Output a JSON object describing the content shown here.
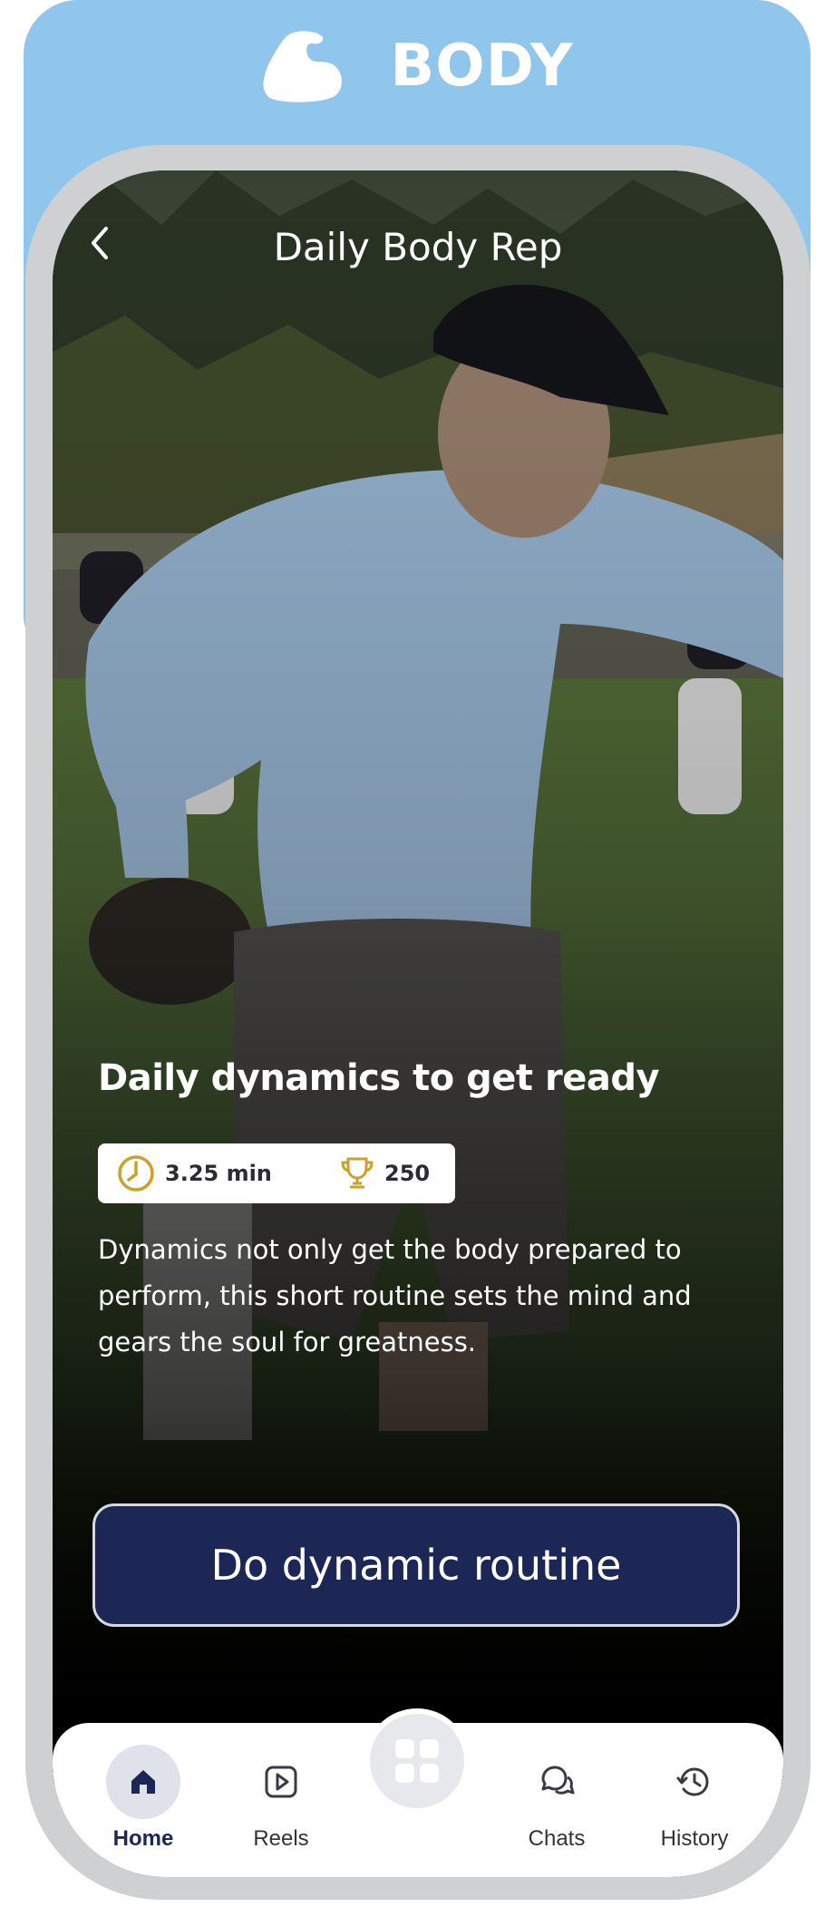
{
  "brand": {
    "name": "BODY",
    "icon": "flexed-bicep-icon"
  },
  "screen": {
    "title": "Daily Body Rep",
    "back_icon": "chevron-left-icon"
  },
  "card": {
    "title": "Daily dynamics to get ready",
    "duration": "3.25 min",
    "points": "250",
    "description": "Dynamics not only get the body prepared to perform, this short routine sets the mind and gears the soul for greatness."
  },
  "cta": {
    "label": "Do dynamic routine"
  },
  "nav": {
    "items": [
      {
        "label": "Home",
        "icon": "home-icon",
        "active": true
      },
      {
        "label": "Reels",
        "icon": "play-square-icon",
        "active": false
      },
      {
        "label": "",
        "icon": "grid-icon",
        "active": false
      },
      {
        "label": "Chats",
        "icon": "chat-bubbles-icon",
        "active": false
      },
      {
        "label": "History",
        "icon": "history-icon",
        "active": false
      }
    ]
  },
  "colors": {
    "brand_band": "#90c5ec",
    "cta_background": "#1c2756",
    "stat_icon_gold": "#c9a227",
    "nav_active": "#1c2756"
  }
}
